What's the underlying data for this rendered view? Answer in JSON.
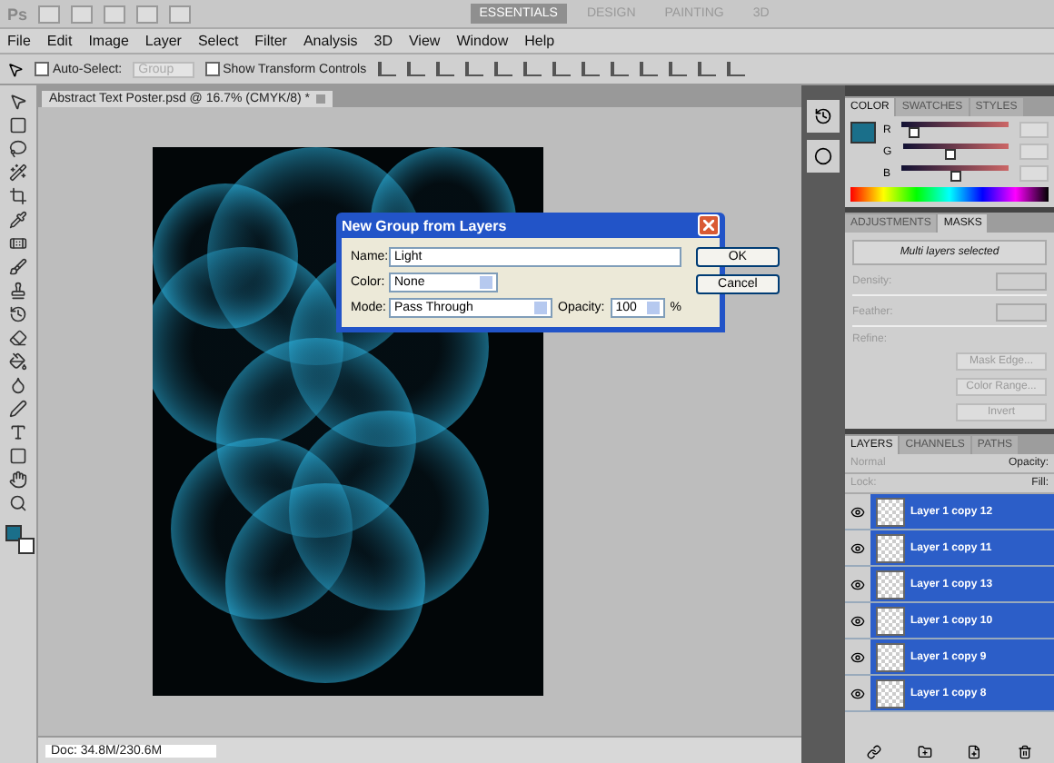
{
  "app_bar": {
    "logo": "Ps",
    "workspaces": [
      {
        "label": "ESSENTIALS",
        "selected": true
      },
      {
        "label": "DESIGN",
        "selected": false
      },
      {
        "label": "PAINTING",
        "selected": false
      },
      {
        "label": "3D",
        "selected": false
      }
    ]
  },
  "menu": [
    "File",
    "Edit",
    "Image",
    "Layer",
    "Select",
    "Filter",
    "Analysis",
    "3D",
    "View",
    "Window",
    "Help"
  ],
  "options_bar": {
    "auto_select": {
      "label": "Auto-Select:",
      "checked": false
    },
    "auto_select_target": "Group",
    "show_transform": {
      "label": "Show Transform Controls",
      "checked": false
    }
  },
  "document": {
    "tab": "Abstract Text Poster.psd @ 16.7% (CMYK/8) *",
    "status": "Doc: 34.8M/230.6M"
  },
  "dialog": {
    "title": "New Group from Layers",
    "name_label": "Name:",
    "name_value": "Light",
    "color_label": "Color:",
    "color_value": "None",
    "mode_label": "Mode:",
    "mode_value": "Pass Through",
    "opacity_label": "Opacity:",
    "opacity_value": "100",
    "opacity_unit": "%",
    "buttons": [
      "OK",
      "Cancel"
    ]
  },
  "color_panel": {
    "tabs": [
      {
        "label": "COLOR",
        "selected": true
      },
      {
        "label": "SWATCHES",
        "selected": false
      },
      {
        "label": "STYLES",
        "selected": false
      }
    ],
    "sliders": [
      {
        "label": "R",
        "level": 0.12
      },
      {
        "label": "G",
        "level": 0.45
      },
      {
        "label": "B",
        "level": 0.5
      }
    ]
  },
  "masks_panel": {
    "tabs": [
      {
        "label": "ADJUSTMENTS",
        "selected": false
      },
      {
        "label": "MASKS",
        "selected": true
      }
    ],
    "message": "Multi layers selected",
    "fields": [
      "Density:",
      "Feather:"
    ],
    "refine_label": "Refine:",
    "buttons": [
      "Mask Edge...",
      "Color Range...",
      "Invert"
    ]
  },
  "layers_panel": {
    "tabs": [
      {
        "label": "LAYERS",
        "selected": true
      },
      {
        "label": "CHANNELS",
        "selected": false
      },
      {
        "label": "PATHS",
        "selected": false
      }
    ],
    "blend_mode": "Normal",
    "opacity_label": "Opacity:",
    "lock_label": "Lock:",
    "fill_label": "Fill:",
    "layers": [
      {
        "name": "Layer 1 copy 12",
        "selected": true,
        "visible": true
      },
      {
        "name": "Layer 1 copy 11",
        "selected": true,
        "visible": true
      },
      {
        "name": "Layer 1 copy 13",
        "selected": true,
        "visible": true
      },
      {
        "name": "Layer 1 copy 10",
        "selected": true,
        "visible": true
      },
      {
        "name": "Layer 1 copy 9",
        "selected": true,
        "visible": true
      },
      {
        "name": "Layer 1 copy 8",
        "selected": true,
        "visible": true
      }
    ]
  }
}
